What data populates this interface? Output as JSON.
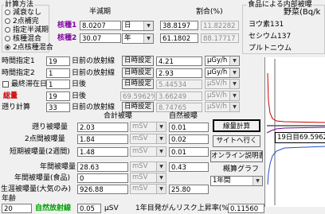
{
  "calc_method": {
    "title": "計算方法",
    "options": [
      {
        "label": "減衰なし",
        "selected": false
      },
      {
        "label": "2点補完",
        "selected": false
      },
      {
        "label": "指定半減期",
        "selected": false
      },
      {
        "label": "核種混合",
        "selected": false
      },
      {
        "label": "2点核種混合",
        "selected": true
      }
    ]
  },
  "half_life": {
    "header": "半減期",
    "ratio_header": "割合(%)",
    "nuclide1": {
      "label": "核種1",
      "value": "8.0207",
      "unit": "日",
      "ratio": "38.8197",
      "ratio2": "11.82282"
    },
    "nuclide2": {
      "label": "核種2",
      "value": "30.07",
      "unit": "年",
      "ratio": "61.1802",
      "ratio2": "88.17717"
    }
  },
  "food_panel": {
    "title": "食品による内部被曝",
    "vegetable_label": "野菜(Bq/k",
    "items": [
      "ヨウ素131",
      "セシウム137",
      "プルトニウム"
    ]
  },
  "time_rows": [
    {
      "label": "時間指定1",
      "value": "19",
      "text": "日前の放射線",
      "button": "日時設定",
      "dose": "4.21",
      "unit": "µGy/h",
      "disabled": false
    },
    {
      "label": "時間指定2",
      "value": "1",
      "text": "日前の放射線",
      "button": "日時設定",
      "dose": "2.93",
      "unit": "µGy/h",
      "disabled": false
    },
    {
      "label": "最終滞在日",
      "value": "1",
      "text": "日後",
      "button": "日時設定",
      "dose": "5.44534",
      "unit": "µSV/h",
      "disabled": true
    }
  ],
  "total": {
    "label": "総量",
    "value": "19",
    "text": "日後",
    "percent": "69.5962%",
    "dose": "3.66249",
    "unit": "µSV/h"
  },
  "retro": {
    "label": "遡り計算",
    "value": "33",
    "text": "日前の放射線",
    "button": "日時設定",
    "dose": "8.74765",
    "unit": "µSV/h"
  },
  "totals_header": {
    "total": "合計被曝",
    "natural": "自然被曝"
  },
  "exposures": [
    {
      "label": "遡り被曝量",
      "total": "2.03",
      "unit": "mSV",
      "natural": "0.01"
    },
    {
      "label": "2点間被曝量",
      "total": "1.84",
      "unit": "mSV",
      "natural": "0.02"
    },
    {
      "label": "短期被曝量(2週間)",
      "total": "1.48",
      "unit": "mSV",
      "natural": "0.01"
    },
    {
      "label": "年間被曝量",
      "total": "28.63",
      "unit": "mSV",
      "natural": "0.43"
    },
    {
      "label": "年間被曝量(食品)",
      "total": "0",
      "unit": "mSV",
      "natural": ""
    },
    {
      "label": "生涯被曝量(大気のみ)",
      "total": "926.88",
      "unit": "mSV",
      "natural": "25.80"
    }
  ],
  "buttons": {
    "calc": "線量計算",
    "site": "サイトへ行く",
    "manual": "オンライン説明書"
  },
  "graph": {
    "label": "概算グラフ",
    "period": "1年間",
    "tooltip": "19日目69.5962%"
  },
  "age": {
    "label": "年齢",
    "value": "20"
  },
  "natural_rad": {
    "label": "自然放射線",
    "value": "0.05",
    "unit": "µSV"
  },
  "risk": {
    "label": "1年目発がんリスク上昇率(%)",
    "value": "0.11560"
  }
}
